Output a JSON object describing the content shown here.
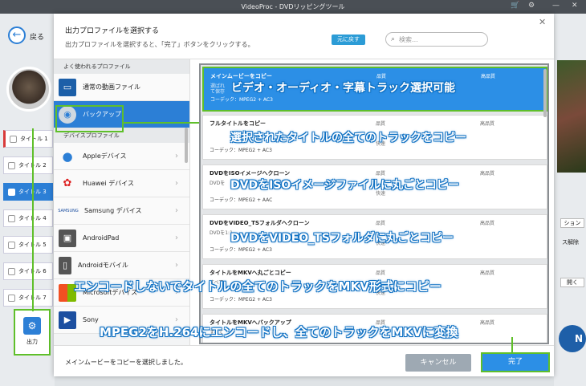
{
  "app": {
    "title": "VideoProc - DVDリッピングツール"
  },
  "left": {
    "back": "戻る",
    "titles": [
      "タイトル 1",
      "タイトル 2",
      "タイトル 3",
      "タイトル 4",
      "タイトル 5",
      "タイトル 6",
      "タイトル 7"
    ],
    "output": "出力"
  },
  "right": {
    "btn1": "ション",
    "t1": "ス解除",
    "btn2": "開く",
    "run": "N"
  },
  "dialog": {
    "title": "出力プロファイルを選択する",
    "subtitle": "出力プロファイルを選択すると、「完了」ボタンをクリックする。",
    "reset": "元に戻す",
    "search_placeholder": "検索...",
    "categories": {
      "fav_header": "よく使われるプロファイル",
      "common": "通常の動画ファイル",
      "backup": "バックアップ",
      "device_header": "デバイスプロファイル",
      "devices": [
        "Appleデバイス",
        "Huawei デバイス",
        "Samsung デバイス",
        "AndroidPad",
        "Androidモバイル",
        "Microsoftデバイス",
        "Sony"
      ]
    },
    "cards": [
      {
        "name": "メインムービーをコピー",
        "l2": "選ばれ",
        "l2b": "て保存",
        "codec": "コーデック：MPEG2 + AC3",
        "q1": "品質",
        "q2": "高品質",
        "speed": "",
        "caption": "ビデオ・オーディオ・字幕トラック選択可能"
      },
      {
        "name": "フルタイトルをコピー",
        "l2": "",
        "l2b": "",
        "codec": "コーデック：MPEG2 + AC3",
        "q1": "品質",
        "q2": "高品質",
        "speed": "快速",
        "caption": "選択されたタイトルの全てのトラックをコピー"
      },
      {
        "name": "DVDをISOイメージへクローン",
        "l2": "DVDを",
        "l2b": "",
        "codec": "コーデック：MPEG2 + AAC",
        "q1": "品質",
        "q2": "高品質",
        "speed": "快速",
        "caption": "DVDをISOイメージファイルに丸ごとコピー"
      },
      {
        "name": "DVDをVIDEO_TSフォルダへクローン",
        "l2": "DVDを1:1",
        "l2b": "",
        "codec": "コーデック：MPEG2 + AC3",
        "q1": "品質",
        "q2": "高品質",
        "speed": "快速",
        "caption": "DVDをVIDEO_TSフォルダに丸ごとコピー"
      },
      {
        "name": "タイトルをMKVへ丸ごとコピー",
        "l2": "すべて",
        "l2b": "",
        "codec": "コーデック：MPEG2 + AC3",
        "q1": "品質",
        "q2": "高品質",
        "speed": "快速",
        "caption": ""
      },
      {
        "name": "タイトルをMKVへバックアップ",
        "l2": "すべて",
        "l2b": "",
        "codec": "",
        "q1": "品質",
        "q2": "高品質",
        "speed": "",
        "caption": ""
      }
    ],
    "caption5": "エンコードしないでタイトルの全てのトラックをMKV形式にコピー",
    "caption6": "MPEG2をH.264にエンコードし、全てのトラックをMKVに変換",
    "footer_text": "メインムービーをコピーを選択しました。",
    "cancel": "キャンセル",
    "done": "完了"
  },
  "colors": {
    "accent": "#2c8fe6",
    "highlight": "#5fbf2a",
    "caption_outline": "#0d6fc2"
  }
}
